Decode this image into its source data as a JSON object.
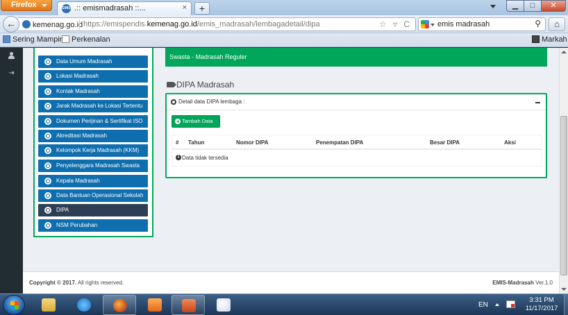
{
  "browser": {
    "menu_label": "Firefox",
    "tab_title": ".:: emismadrasah ::...",
    "tab_close": "×",
    "new_tab": "+",
    "window_min": "▁",
    "window_max": "□",
    "window_close": "✕",
    "site_identity": "kemenag.go.id",
    "url_prefix": "https://emispendis.",
    "url_domain": "kemenag.go.id",
    "url_path": "/emis_madrasah/lembagadetail/dipa",
    "url_icons": "☆ ▿ C",
    "search_value": "emis madrasah",
    "search_icon": "⚲",
    "home_icon": "⌂",
    "back_icon": "←",
    "bookmarks": [
      "Sering Mampir",
      "Perkenalan"
    ],
    "bookmarks_right": "Markah"
  },
  "leftnav": {
    "logout_icon": "⇥"
  },
  "menu": {
    "items": [
      {
        "label": "Data Umum Madrasah"
      },
      {
        "label": "Lokasi Madrasah"
      },
      {
        "label": "Kontak Madrasah"
      },
      {
        "label": "Jarak Madrasah ke Lokasi Tertentu"
      },
      {
        "label": "Dokumen Perijinan & Sertifikat ISO"
      },
      {
        "label": "Akreditasi Madrasah"
      },
      {
        "label": "Kelompok Kerja Madrasah (KKM)"
      },
      {
        "label": "Penyelenggara Madrasah Swasta"
      },
      {
        "label": "Kepala Madrasah"
      },
      {
        "label": "Data Bantuan Operasional Sekolah"
      },
      {
        "label": "DIPA"
      },
      {
        "label": "NSM Perubahan"
      }
    ]
  },
  "alert": {
    "text": "Swasta - Madrasah Reguler"
  },
  "section": {
    "title": "DIPA Madrasah"
  },
  "panel": {
    "title": "Detail data DIPA lembaga :",
    "add_button": "Tambah Data",
    "columns": [
      "#",
      "Tahun",
      "Nomor DIPA",
      "Penempatan DIPA",
      "Besar DIPA",
      "Aksi"
    ],
    "empty_text": "Data tidak tersedia",
    "info_glyph": "i"
  },
  "footer": {
    "copyright_prefix": "Copyright © 2017.",
    "copyright_suffix": " All rights reserved.",
    "app_name": "EMIS-Madrasah",
    "version": " Ver.1.0"
  },
  "taskbar": {
    "lang": "EN",
    "time": "3:31 PM",
    "date": "11/17/2017"
  }
}
